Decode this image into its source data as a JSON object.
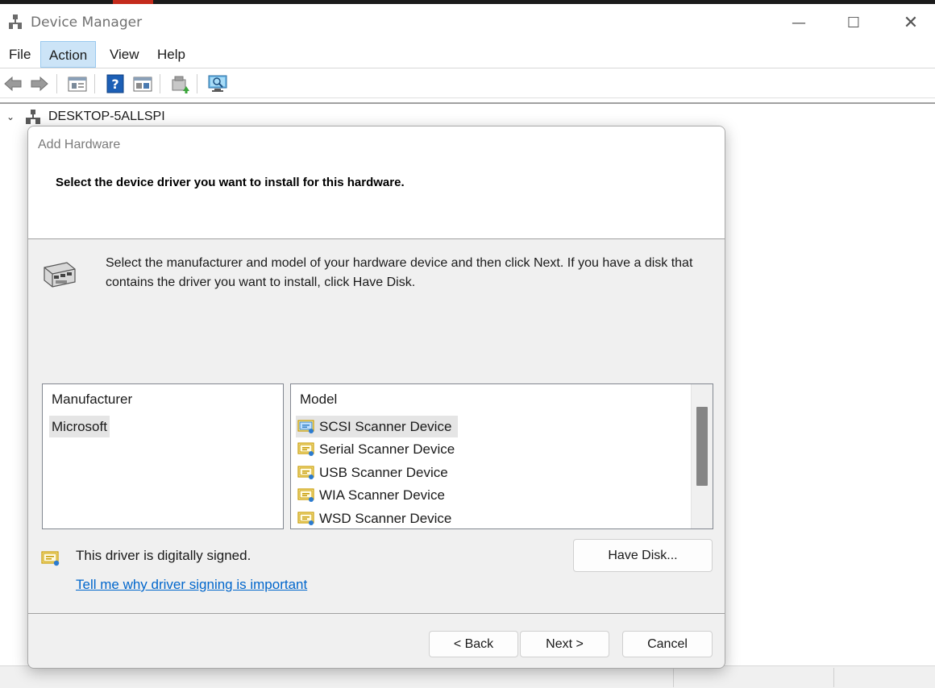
{
  "window": {
    "title": "Device Manager",
    "controls": {
      "minimize": "—",
      "maximize": "☐",
      "close": "✕"
    }
  },
  "menu": {
    "items": [
      {
        "label": "File"
      },
      {
        "label": "Action",
        "active": true
      },
      {
        "label": "View"
      },
      {
        "label": "Help"
      }
    ]
  },
  "toolbar": {
    "icons": [
      "back-arrow-icon",
      "forward-arrow-icon",
      "properties-icon",
      "help-icon",
      "show-hide-pane-icon",
      "update-driver-icon",
      "scan-hardware-icon"
    ]
  },
  "tree": {
    "root_label": "DESKTOP-5ALLSPI",
    "expanded": true
  },
  "dialog": {
    "title": "Add Hardware",
    "heading": "Select the device driver you want to install for this hardware.",
    "instruction": "Select the manufacturer and model of your hardware device and then click Next. If you have a disk that contains the driver you want to install, click Have Disk.",
    "manufacturer": {
      "header": "Manufacturer",
      "items": [
        "Microsoft"
      ],
      "selected": "Microsoft"
    },
    "model": {
      "header": "Model",
      "items": [
        "SCSI Scanner Device",
        "Serial Scanner Device",
        "USB Scanner Device",
        "WIA Scanner Device",
        "WSD Scanner Device"
      ],
      "selected": "SCSI Scanner Device"
    },
    "signed_text": "This driver is digitally signed.",
    "signing_link": "Tell me why driver signing is important",
    "buttons": {
      "have_disk": "Have Disk...",
      "back": "< Back",
      "next": "Next >",
      "cancel": "Cancel"
    }
  },
  "colors": {
    "menu_active_bg": "#cce4f7",
    "link": "#0066cc",
    "dialog_bg": "#f0f0f0",
    "selection_bg": "#e5e5e5"
  }
}
